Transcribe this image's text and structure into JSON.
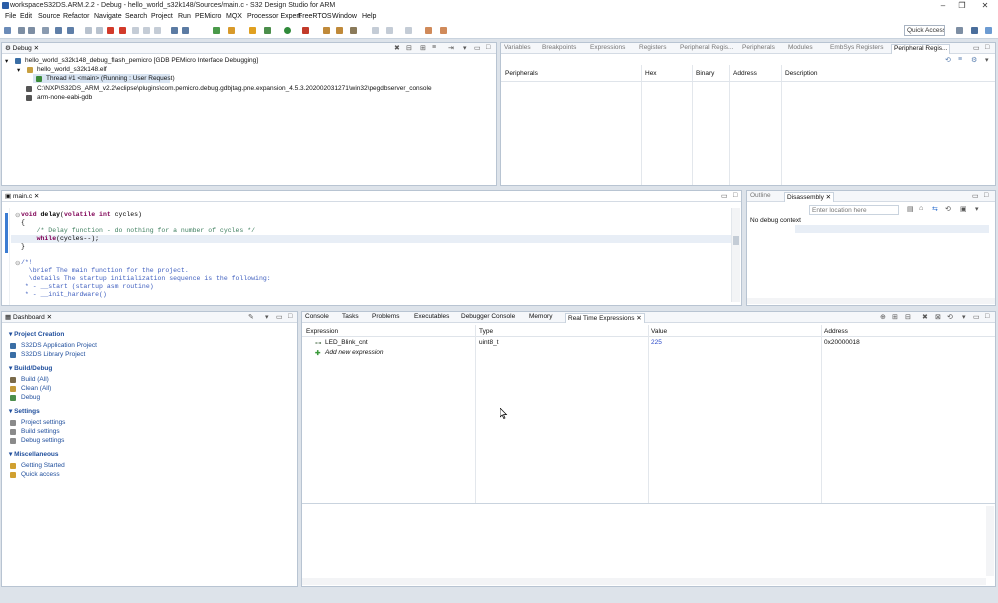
{
  "window": {
    "title": "workspaceS32DS.ARM.2.2 - Debug - hello_world_s32k148/Sources/main.c - S32 Design Studio for ARM",
    "minimize": "–",
    "maximize": "❐",
    "close": "✕"
  },
  "menu": [
    "File",
    "Edit",
    "Source",
    "Refactor",
    "Navigate",
    "Search",
    "Project",
    "Run",
    "PEMicro",
    "MQX",
    "Processor Expert",
    "FreeRTOS",
    "Window",
    "Help"
  ],
  "toolbar": {
    "quick_access": "Quick Access"
  },
  "debug_view": {
    "tab": "Debug",
    "tree": [
      "hello_world_s32k148_debug_flash_pemicro [GDB PEMicro Interface Debugging]",
      "hello_world_s32k148.elf",
      "Thread #1 <main> (Running : User Request)",
      "C:\\NXP\\S32DS_ARM_v2.2\\eclipse\\plugins\\com.pemicro.debug.gdbjtag.pne.expansion_4.5.3.202002031271\\win32\\pegdbserver_console",
      "arm-none-eabi-gdb"
    ]
  },
  "peripheral_view": {
    "tabs": [
      "Variables",
      "Breakpoints",
      "Expressions",
      "Registers",
      "Peripheral Regis...",
      "Peripherals",
      "Modules",
      "EmbSys Registers",
      "Peripheral Regis..."
    ],
    "columns": [
      "Peripherals",
      "Hex",
      "Binary",
      "Address",
      "Description"
    ]
  },
  "editor": {
    "tab": "main.c",
    "lines": [
      "void delay(volatile int cycles)",
      "{",
      "    /* Delay function - do nothing for a number of cycles */",
      "    while(cycles--);",
      "}",
      "",
      "/*!",
      "  \\brief The main function for the project.",
      "  \\details The startup initialization sequence is the following:",
      " * - __start (startup asm routine)",
      " * - __init_hardware()"
    ]
  },
  "disassembly_view": {
    "tabs": [
      "Outline",
      "Disassembly"
    ],
    "location_placeholder": "Enter location here",
    "status": "No debug context"
  },
  "dashboard": {
    "tab": "Dashboard",
    "sections": [
      {
        "title": "Project Creation",
        "items": [
          "S32DS Application Project",
          "S32DS Library Project"
        ]
      },
      {
        "title": "Build/Debug",
        "items": [
          "Build  (All)",
          "Clean  (All)",
          "Debug"
        ]
      },
      {
        "title": "Settings",
        "items": [
          "Project settings",
          "Build settings",
          "Debug settings"
        ]
      },
      {
        "title": "Miscellaneous",
        "items": [
          "Getting Started",
          "Quick access"
        ]
      }
    ]
  },
  "bottom_view": {
    "tabs": [
      "Console",
      "Tasks",
      "Problems",
      "Executables",
      "Debugger Console",
      "Memory",
      "Real Time Expressions"
    ],
    "columns": [
      "Expression",
      "Type",
      "Value",
      "Address"
    ],
    "rows": [
      {
        "expression": "LED_Blink_cnt",
        "type": "uint8_t",
        "value": "225",
        "address": "0x20000018"
      }
    ],
    "add_expression": "Add new expression"
  },
  "colors": {
    "accent": "#2b5ea7",
    "link": "#1f4e9c",
    "value": "#2a48c8"
  }
}
